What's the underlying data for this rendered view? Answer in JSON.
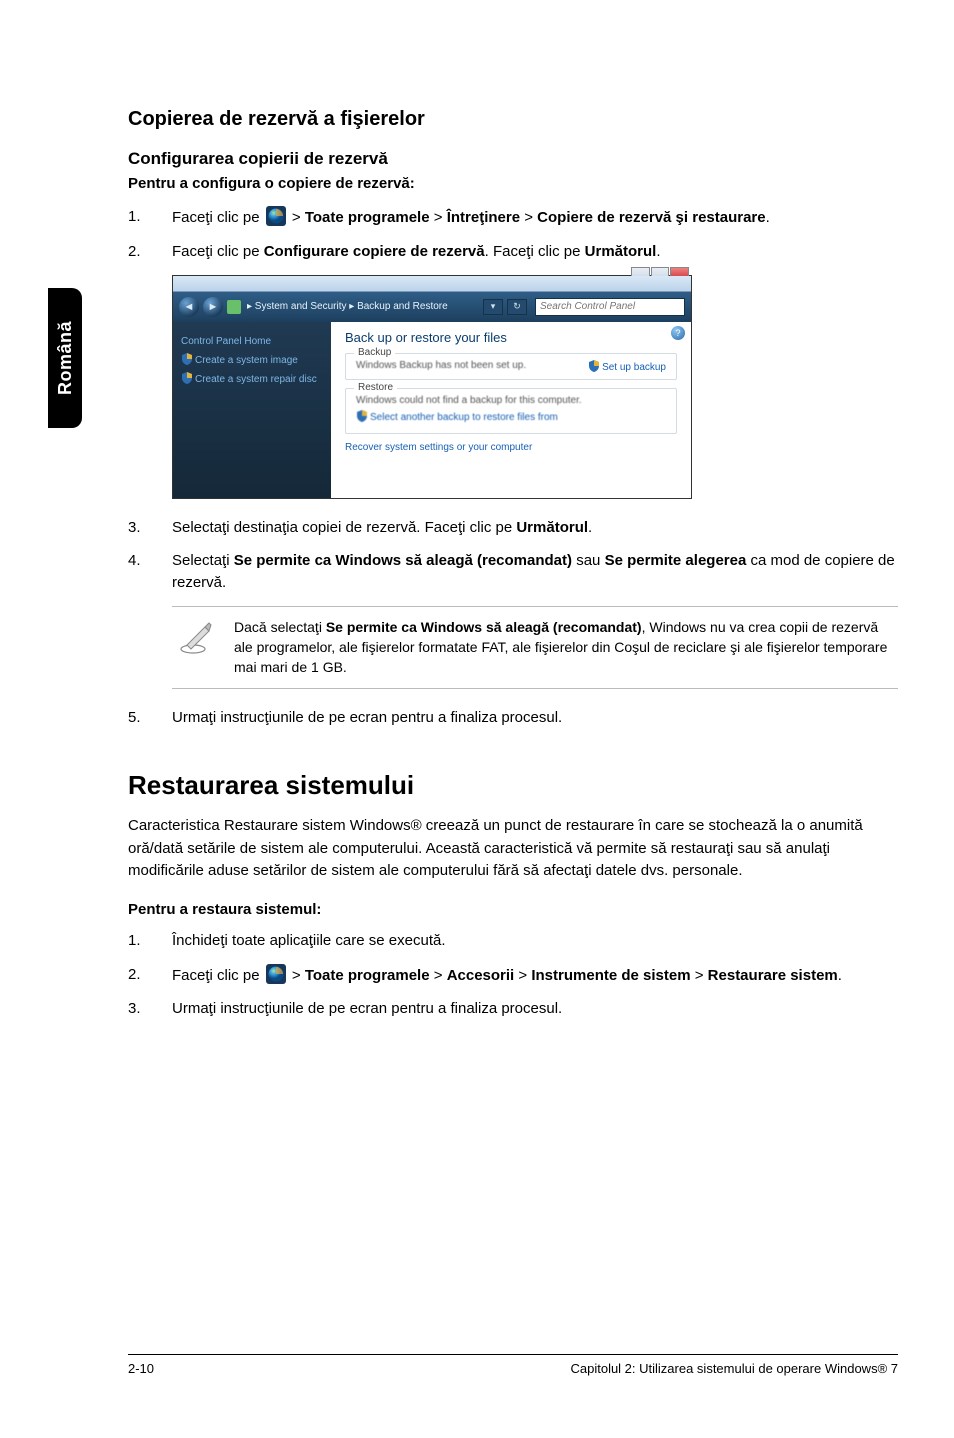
{
  "sideTab": "Română",
  "heading1": "Copierea de rezervă a fişierelor",
  "sub1": "Configurarea copierii de rezervă",
  "lead1": "Pentru a configura o copiere de rezervă:",
  "steps1": {
    "s1": {
      "num": "1.",
      "pre": "Faceţi clic pe ",
      "gt1": " > ",
      "b1": "Toate programele",
      "gt2": " > ",
      "b2": "Întreţinere",
      "gt3": " > ",
      "b3": "Copiere de rezervă şi restaurare",
      "post": "."
    },
    "s2": {
      "num": "2.",
      "pre": "Faceţi clic pe ",
      "b1": "Configurare copiere de rezervă",
      "mid": ". Faceţi clic pe ",
      "b2": "Următorul",
      "post": "."
    },
    "s3": {
      "num": "3.",
      "pre": "Selectaţi destinaţia copiei de rezervă. Faceţi clic pe ",
      "b1": "Următorul",
      "post": "."
    },
    "s4": {
      "num": "4.",
      "pre": "Selectaţi ",
      "b1": "Se permite ca Windows să aleagă (recomandat)",
      "mid": " sau ",
      "b2": "Se permite alegerea",
      "post": " ca mod de copiere de rezervă."
    },
    "s5": {
      "num": "5.",
      "text": "Urmaţi instrucţiunile de pe ecran pentru a finaliza procesul."
    }
  },
  "note": {
    "pre": "Dacă selectaţi ",
    "b": "Se permite ca Windows să aleagă (recomandat)",
    "post": ", Windows nu va crea copii de rezervă ale programelor, ale fişierelor formatate FAT, ale fişierelor din Coşul de reciclare şi ale fişierelor temporare mai mari de 1 GB."
  },
  "heading2": "Restaurarea sistemului",
  "para2": "Caracteristica Restaurare sistem Windows® creează un punct de restaurare în care se stochează la o anumită oră/dată setările de sistem ale computerului. Această caracteristică vă permite să restauraţi sau să anulaţi modificările aduse setărilor de sistem ale computerului fără să afectaţi datele dvs. personale.",
  "lead2": "Pentru a restaura sistemul:",
  "steps2": {
    "s1": {
      "num": "1.",
      "text": "Închideţi toate aplicaţiile care se execută."
    },
    "s2": {
      "num": "2.",
      "pre": "Faceţi clic pe ",
      "gt1": " > ",
      "b1": "Toate programele",
      "gt2": " > ",
      "b2": "Accesorii",
      "gt3": " > ",
      "b3": "Instrumente de sistem",
      "gt4": " > ",
      "b4": "Restaurare sistem",
      "post": "."
    },
    "s3": {
      "num": "3.",
      "text": "Urmaţi instrucţiunile de pe ecran pentru a finaliza procesul."
    }
  },
  "screenshot": {
    "address": "▸ System and Security ▸ Backup and Restore",
    "searchPlaceholder": "Search Control Panel",
    "leftHome": "Control Panel Home",
    "leftLink1": "Create a system image",
    "leftLink2": "Create a system repair disc",
    "mainHeading": "Back up or restore your files",
    "backupLabel": "Backup",
    "backupText": "Windows Backup has not been set up.",
    "backupLink": "Set up backup",
    "restoreLabel": "Restore",
    "restoreText1": "Windows could not find a backup for this computer.",
    "restoreText2": "Select another backup to restore files from",
    "recoverLink": "Recover system settings or your computer"
  },
  "footer": {
    "left": "2-10",
    "right": "Capitolul 2: Utilizarea sistemului de operare Windows® 7"
  }
}
